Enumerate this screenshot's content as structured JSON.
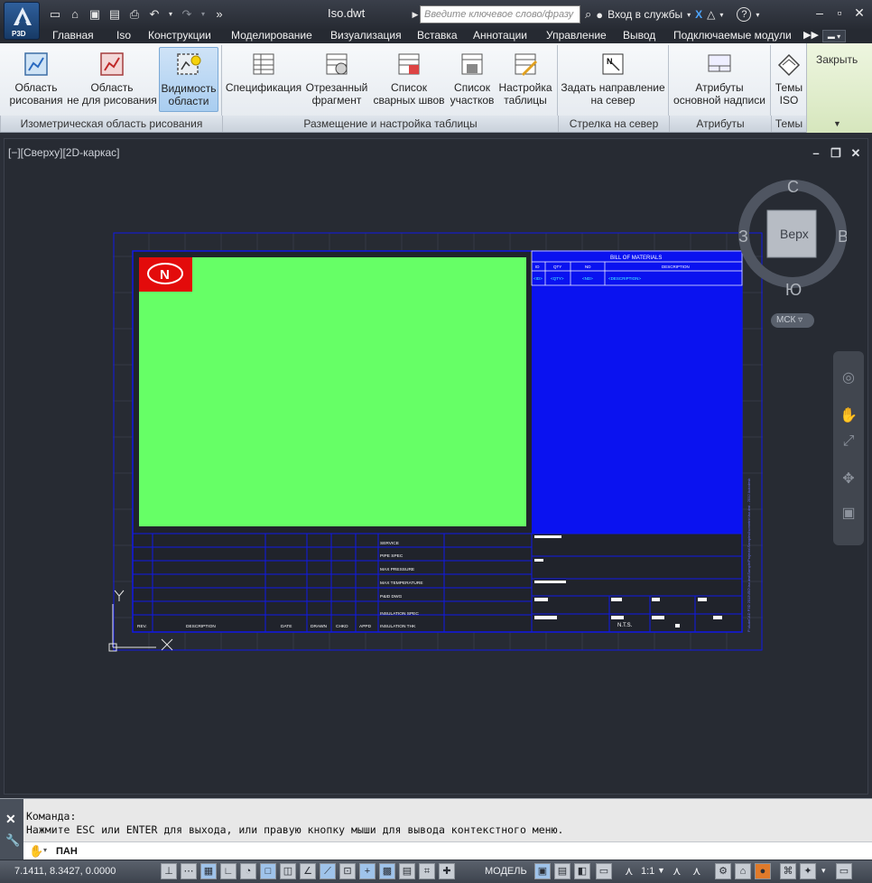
{
  "app": {
    "name": "P3D",
    "doc_title": "Iso.dwt",
    "search_placeholder": "Введите ключевое слово/фразу",
    "signin": "Вход в службы"
  },
  "tabs": [
    {
      "label": "Главная"
    },
    {
      "label": "Iso"
    },
    {
      "label": "Конструкции"
    },
    {
      "label": "Моделирование"
    },
    {
      "label": "Визуализация"
    },
    {
      "label": "Вставка"
    },
    {
      "label": "Аннотации"
    },
    {
      "label": "Управление"
    },
    {
      "label": "Вывод"
    },
    {
      "label": "Подключаемые модули"
    }
  ],
  "ribbon": {
    "buttons": [
      {
        "line1": "Область",
        "line2": "рисования"
      },
      {
        "line1": "Область",
        "line2": "не для рисования"
      },
      {
        "line1": "Видимость",
        "line2": "области"
      },
      {
        "line1": "Спецификация",
        "line2": ""
      },
      {
        "line1": "Отрезанный",
        "line2": "фрагмент"
      },
      {
        "line1": "Список",
        "line2": "сварных швов"
      },
      {
        "line1": "Список",
        "line2": "участков"
      },
      {
        "line1": "Настройка",
        "line2": "таблицы"
      },
      {
        "line1": "Задать направление",
        "line2": "на север"
      },
      {
        "line1": "Атрибуты",
        "line2": "основной надписи"
      },
      {
        "line1": "Темы",
        "line2": "ISO"
      }
    ],
    "groups": [
      {
        "label": "Изометрическая область рисования"
      },
      {
        "label": "Размещение и настройка таблицы"
      },
      {
        "label": "Стрелка на север"
      },
      {
        "label": "Атрибуты"
      },
      {
        "label": "Темы"
      }
    ],
    "close_label": "Закрыть"
  },
  "viewport": {
    "label": "[−][Сверху][2D-каркас]",
    "viewcube": {
      "top": "Верх",
      "north": "С",
      "south": "Ю",
      "west": "З",
      "east": "В"
    },
    "ucs": "МСК",
    "axis_y": "Y",
    "axis_x": "X"
  },
  "titleblock": {
    "logo_letter": "N",
    "bom_title": "BILL OF MATERIALS",
    "bom_headers": [
      "ID",
      "QTY",
      "ND",
      "DESCRIPTION"
    ],
    "bom_row": [
      "<ID>",
      "<QTY>",
      "<ND>",
      "<DESCRIPTION>"
    ],
    "rev_headers": [
      "REV.",
      "DESCRIPTION",
      "DATE",
      "DRAWN",
      "CHKD",
      "APPD"
    ],
    "fields": [
      "SERVICE",
      "PIPE SPEC",
      "MAX PRESSURE",
      "MAX TEMPERATURE",
      "P&ID DWG",
      "INSULATION SPEC",
      "INSULATION THK"
    ],
    "nts": "N.T.S.",
    "side_text": "P:\\AutoCAD P3D 2013\\ISO\\Iso.dwt\\Sample\\Projects\\Samples\\Isometric\\Iso.dwt - 2012 Autodesk"
  },
  "command": {
    "line1": "Команда:",
    "line2": "Нажмите ESC или ENTER для выхода, или правую кнопку мыши для вывода контекстного меню.",
    "current": "ПАН"
  },
  "status": {
    "coords": "7.1411, 8.3427, 0.0000",
    "model": "МОДЕЛЬ",
    "scale": "1:1"
  },
  "colors": {
    "drawing_area": "#66ff66",
    "bom_fill": "#0a12f0",
    "frame": "#1018e8",
    "logo_red": "#e30b0b"
  }
}
